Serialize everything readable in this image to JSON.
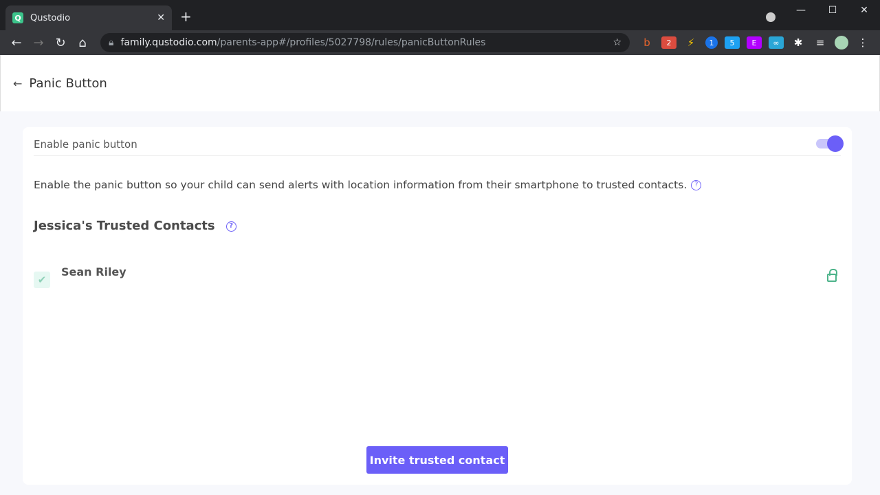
{
  "browser": {
    "tab_title": "Qustodio",
    "favicon_letter": "Q",
    "url_host": "family.qustodio.com",
    "url_path": "/parents-app#/profiles/5027798/rules/panicButtonRules",
    "ext_badges": [
      "2",
      "5"
    ],
    "ext_letter": "E"
  },
  "header": {
    "title": "Panic Button"
  },
  "settings": {
    "enable_label": "Enable panic button",
    "enabled": true,
    "description": "Enable the panic button so your child can send alerts with location information from their smartphone to trusted contacts."
  },
  "contacts": {
    "title": "Jessica's Trusted Contacts",
    "items": [
      {
        "name": "Sean Riley",
        "checked": true,
        "locked": true
      }
    ]
  },
  "actions": {
    "invite_label": "Invite trusted contact"
  },
  "colors": {
    "accent": "#6b5ff8",
    "success": "#4db38a"
  }
}
